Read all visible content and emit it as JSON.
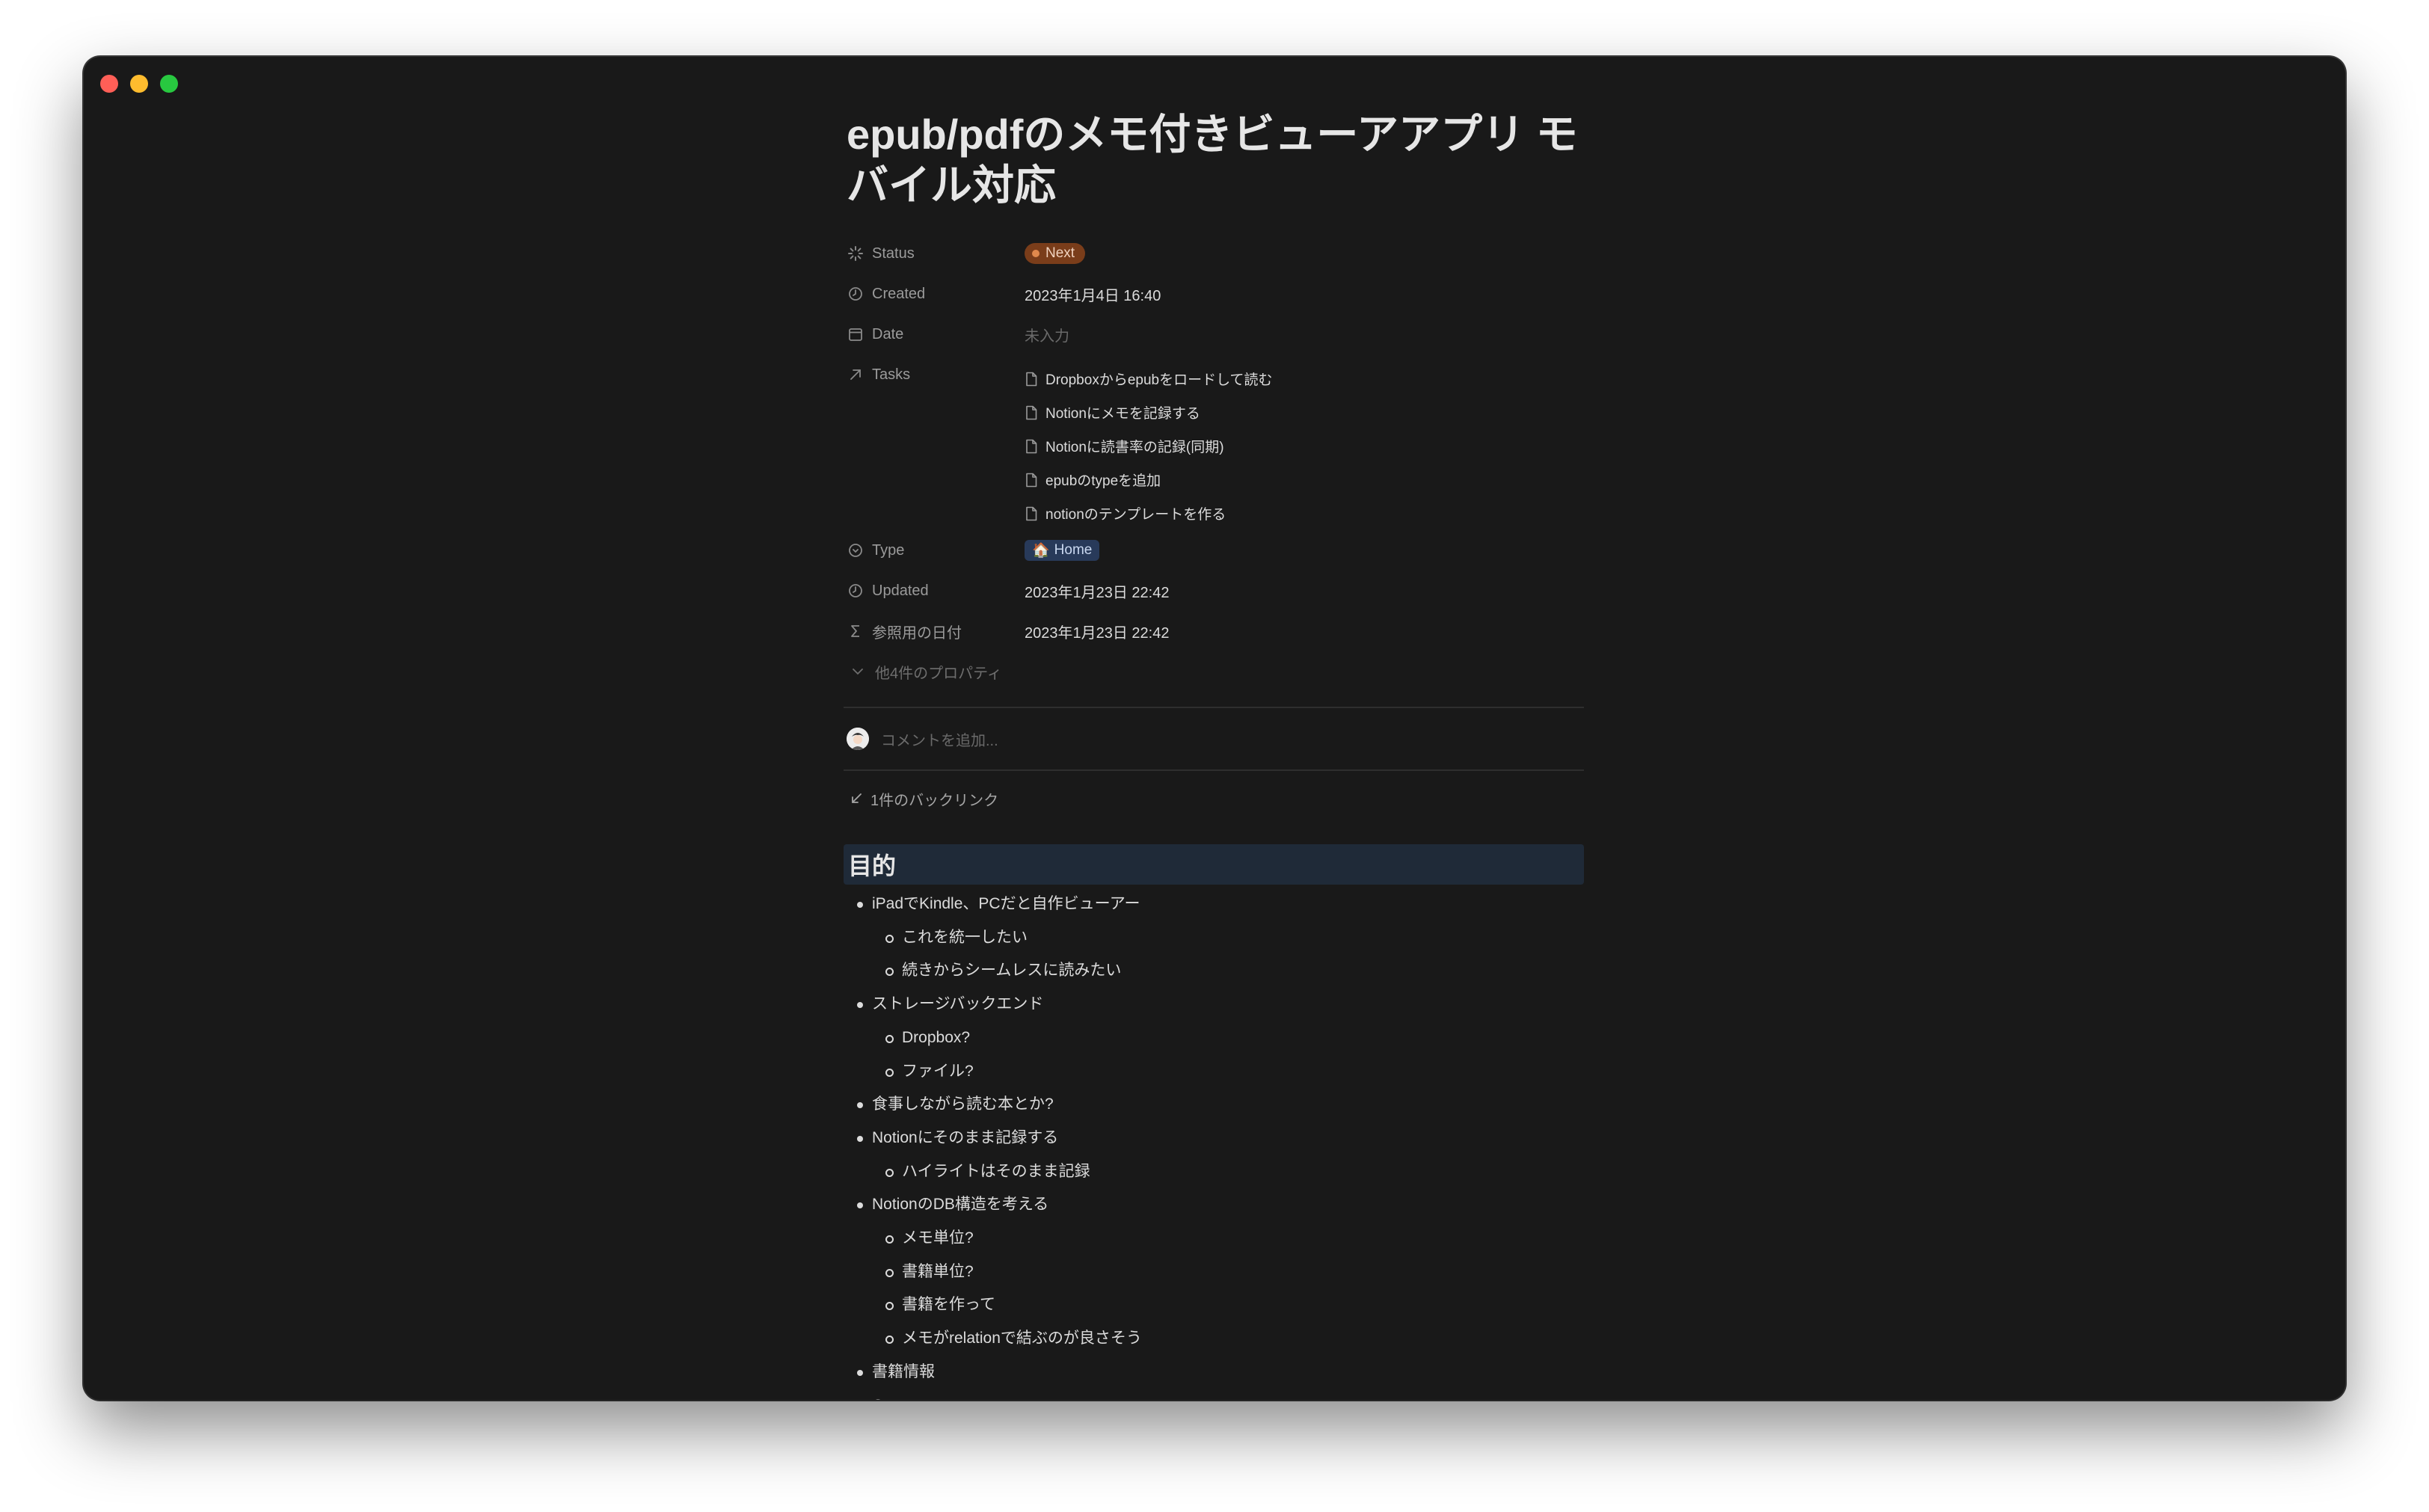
{
  "page": {
    "title": "epub/pdfのメモ付きビューアアプリ モバイル対応"
  },
  "properties": {
    "status": {
      "label": "Status",
      "value": "Next",
      "icon": "status-icon"
    },
    "created": {
      "label": "Created",
      "value": "2023年1月4日 16:40",
      "icon": "clock-icon"
    },
    "date": {
      "label": "Date",
      "value": "未入力",
      "icon": "calendar-icon"
    },
    "tasks": {
      "label": "Tasks",
      "icon": "relation-arrow-icon",
      "items": [
        "Dropboxからepubをロードして読む",
        "Notionにメモを記録する",
        "Notionに読書率の記録(同期)",
        "epubのtypeを追加",
        "notionのテンプレートを作る"
      ]
    },
    "type": {
      "label": "Type",
      "value": "Home",
      "emoji": "🏠",
      "icon": "select-icon"
    },
    "updated": {
      "label": "Updated",
      "value": "2023年1月23日 22:42",
      "icon": "clock-icon"
    },
    "ref_date": {
      "label": "参照用の日付",
      "value": "2023年1月23日 22:42",
      "icon": "formula-sigma-icon"
    },
    "more": "他4件のプロパティ"
  },
  "comment": {
    "placeholder": "コメントを追加..."
  },
  "backlinks": {
    "label": "1件のバックリンク"
  },
  "content": {
    "heading": "目的",
    "bullets": [
      {
        "text": "iPadでKindle、PCだと自作ビューアー",
        "children": [
          "これを統一したい",
          "続きからシームレスに読みたい"
        ]
      },
      {
        "text": "ストレージバックエンド",
        "children": [
          "Dropbox?",
          "ファイル?"
        ]
      },
      {
        "text": "食事しながら読む本とか?",
        "children": []
      },
      {
        "text": "Notionにそのまま記録する",
        "children": [
          "ハイライトはそのまま記録"
        ]
      },
      {
        "text": "NotionのDB構造を考える",
        "children": [
          "メモ単位?",
          "書籍単位?",
          "書籍を作って",
          "メモがrelationで結ぶのが良さそう"
        ]
      },
      {
        "text": "書籍情報",
        "children": []
      },
      {
        "text": "Creator",
        "children": []
      }
    ]
  },
  "colors": {
    "window_bg": "#191919",
    "status_badge_bg": "#7a3d1a",
    "type_badge_bg": "#283a5a",
    "heading_highlight": "#1f2a38"
  }
}
